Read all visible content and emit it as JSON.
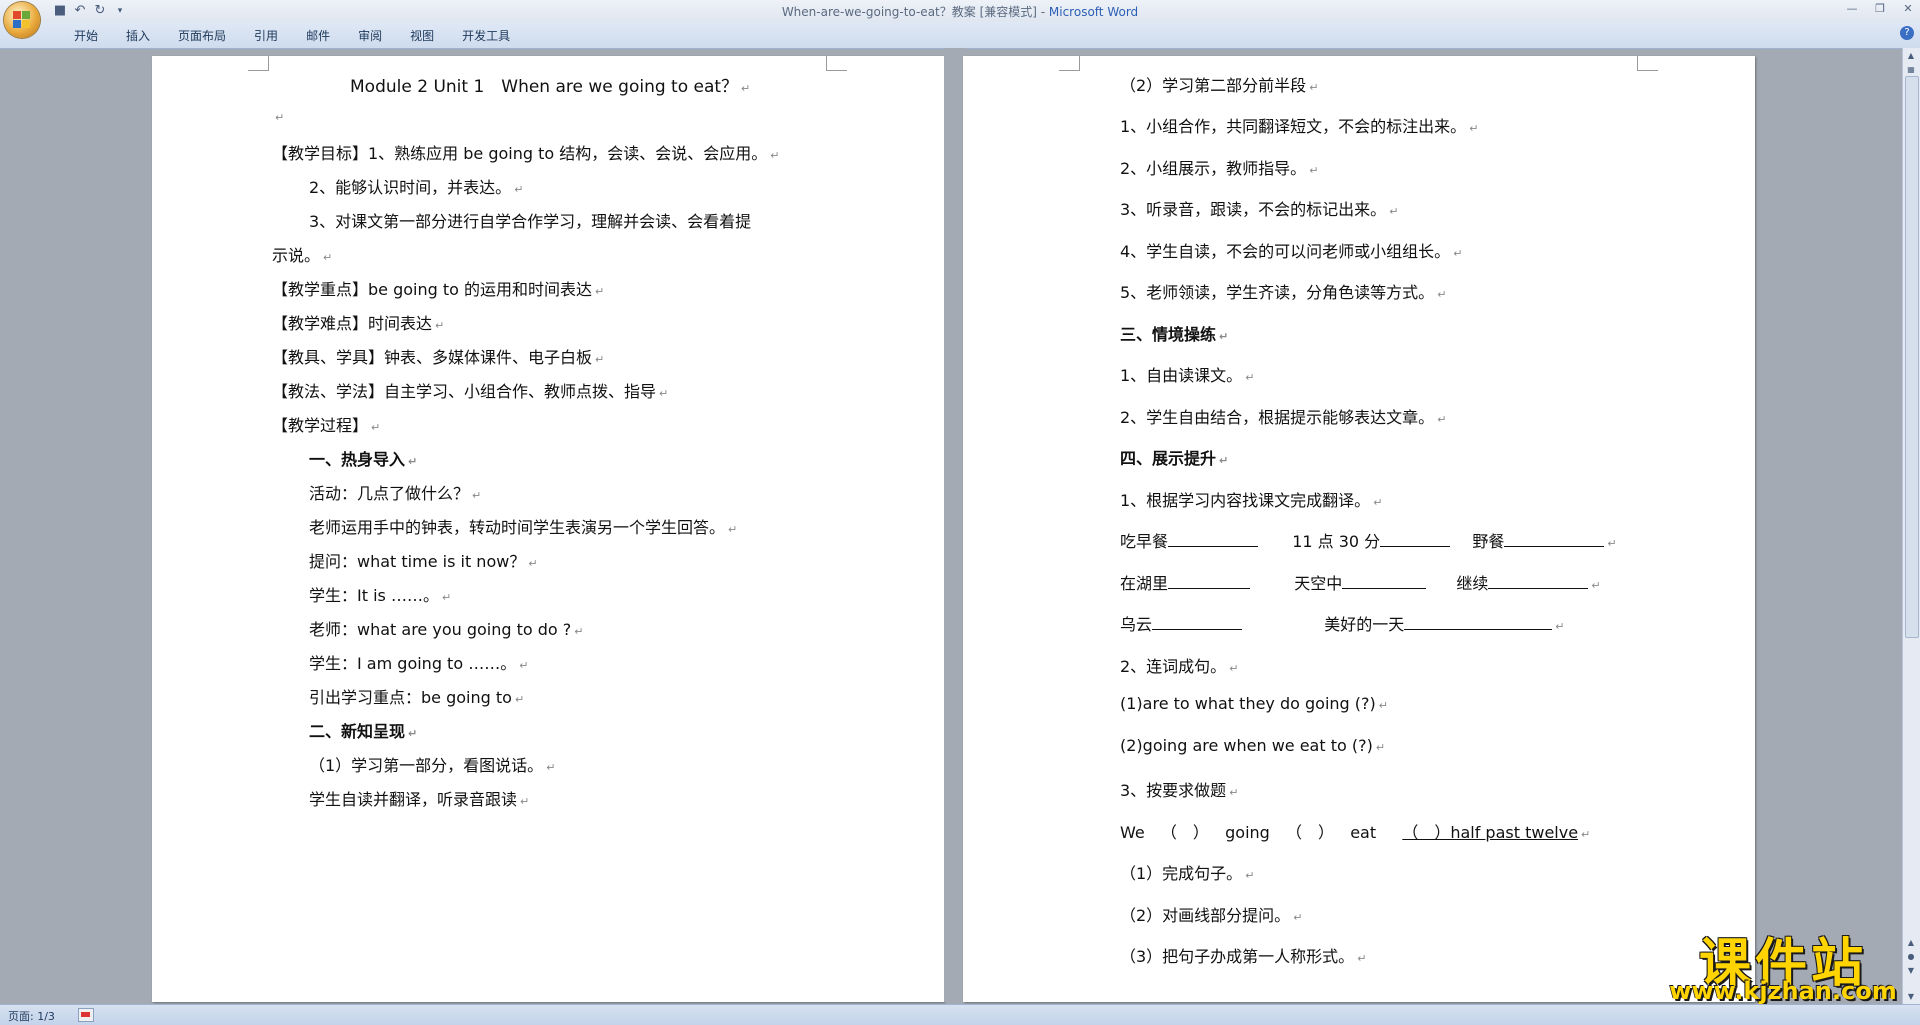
{
  "window": {
    "title": "When-are-we-going-to-eat？教案 [兼容模式] - ",
    "app_name": "Microsoft Word"
  },
  "ribbon": {
    "tabs": [
      "开始",
      "插入",
      "页面布局",
      "引用",
      "邮件",
      "审阅",
      "视图",
      "开发工具"
    ]
  },
  "statusbar": {
    "page_info": "页面: 1/3"
  },
  "page1": {
    "title": "Module 2 Unit 1　When are we going to eat？",
    "lines": [
      "【教学目标】1、熟练应用 be going to  结构，会读、会说、会应用。",
      "2、能够认识时间，并表达。",
      "3、对课文第一部分进行自学合作学习，理解并会读、会看着提",
      "示说。",
      "【教学重点】be going to 的运用和时间表达",
      "【教学难点】时间表达",
      "【教具、学具】钟表、多媒体课件、电子白板",
      "【教法、学法】自主学习、小组合作、教师点拨、指导",
      "【教学过程】",
      "一、热身导入",
      "活动：几点了做什么？",
      "老师运用手中的钟表，转动时间学生表演另一个学生回答。",
      "提问：what time is it now？",
      "学生：It is  ……。",
      "老师：what are you going to do ?",
      "学生：I am going to  ……。",
      "引出学习重点：be going to",
      "二、新知呈现",
      "（1）学习第一部分，看图说话。",
      "学生自读并翻译，听录音跟读"
    ]
  },
  "page2": {
    "lines": [
      "（2）学习第二部分前半段",
      "1、小组合作，共同翻译短文，不会的标注出来。",
      "2、小组展示，教师指导。",
      "3、听录音，跟读，不会的标记出来。",
      "4、学生自读，不会的可以问老师或小组组长。",
      "5、老师领读，学生齐读，分角色读等方式。",
      "三、情境操练",
      "1、自由读课文。",
      "2、学生自由结合，根据提示能够表达文章。",
      "四、展示提升",
      "1、根据学习内容找课文完成翻译。",
      "2、连词成句。",
      "(1)are to what they do going (?)",
      "(2)going are when we eat to (?)",
      "3、按要求做题",
      "（1）完成句子。",
      "（2）对画线部分提问。",
      "（3）把句子办成第一人称形式。"
    ],
    "translate_row1": [
      "吃早餐",
      "11 点 30 分",
      "野餐"
    ],
    "translate_row2": [
      "在湖里",
      "天空中",
      "继续"
    ],
    "translate_row3": [
      "乌云",
      "美好的一天"
    ],
    "exercise": {
      "we": "We",
      "paren1": "（　）",
      "going": "going",
      "paren2": "（　）",
      "eat": "eat",
      "underlined": "（　）half past twelve"
    }
  },
  "watermark": {
    "cn": "课件站",
    "url": "www.kjzhan.com"
  }
}
